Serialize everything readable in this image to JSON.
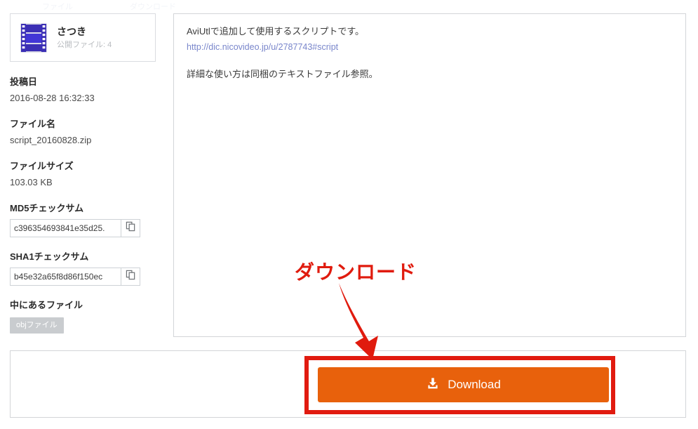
{
  "page": {
    "top_ghost_fragments": [
      "ファイル",
      "ダウンロード"
    ]
  },
  "user_card": {
    "avatar_icon": "film-strip-icon",
    "name": "さつき",
    "public_files_label": "公開ファイル: 4"
  },
  "details": {
    "posted": {
      "label": "投稿日",
      "value": "2016-08-28 16:32:33"
    },
    "filename": {
      "label": "ファイル名",
      "value": "script_20160828.zip"
    },
    "filesize": {
      "label": "ファイルサイズ",
      "value": "103.03 KB"
    },
    "md5": {
      "label": "MD5チェックサム",
      "value": "c396354693841e35d25.",
      "copy_icon": "copy-icon"
    },
    "sha1": {
      "label": "SHA1チェックサム",
      "value": "b45e32a65f8d86f150ec",
      "copy_icon": "copy-icon"
    },
    "contents": {
      "label": "中にあるファイル",
      "tags": [
        "objファイル"
      ]
    }
  },
  "description": {
    "line1": "AviUtlで追加して使用するスクリプトです。",
    "link_text": "http://dic.nicovideo.jp/u/2787743#script",
    "line2": "詳細な使い方は同梱のテキストファイル参照。"
  },
  "download": {
    "button_label": "Download",
    "button_icon": "download-icon",
    "button_color": "#e8610c"
  },
  "annotation": {
    "text": "ダウンロード",
    "color": "#e01b0e",
    "arrow_icon": "down-arrow-annotation-icon",
    "highlight_icon": "red-highlight-box"
  }
}
